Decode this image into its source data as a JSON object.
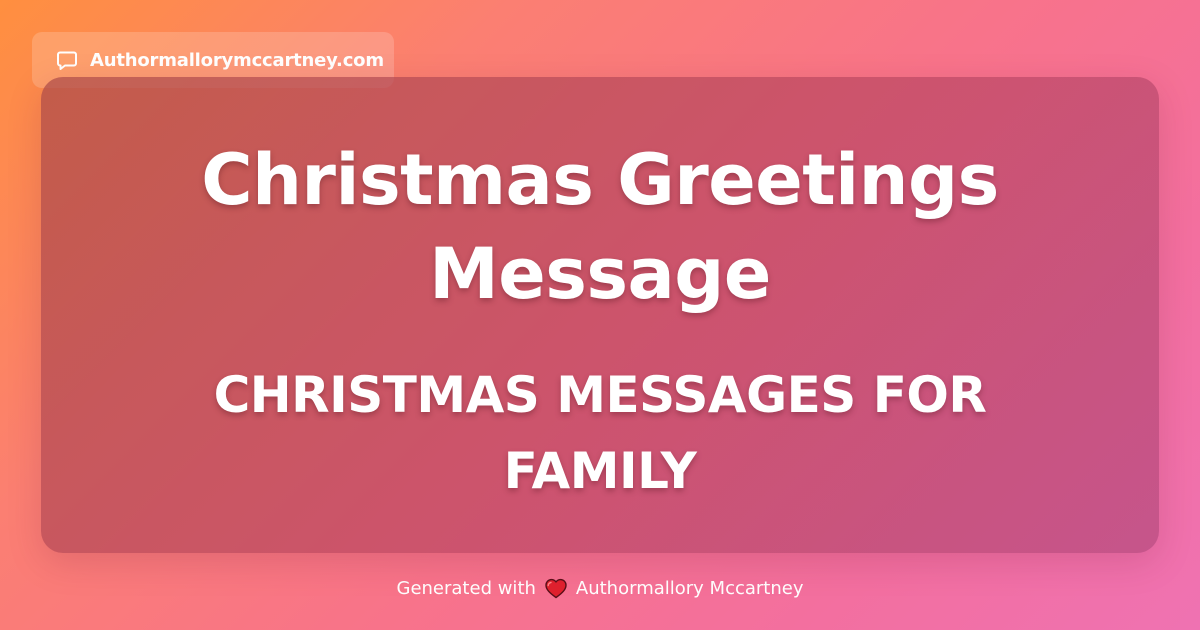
{
  "site": {
    "icon": "speech-bubble-icon",
    "label": "Authormallorymccartney.com"
  },
  "card": {
    "title": "Christmas Greetings Message",
    "subtitle": "CHRISTMAS MESSAGES FOR FAMILY"
  },
  "footer": {
    "prefix": "Generated with",
    "icon": "heart-icon",
    "brand": "Authormallory Mccartney"
  },
  "colors": {
    "background_start": "#ff8f3f",
    "background_end": "#ef72b2",
    "card": "#b8445f",
    "text": "#ffffff",
    "heart": "#e0212e"
  }
}
